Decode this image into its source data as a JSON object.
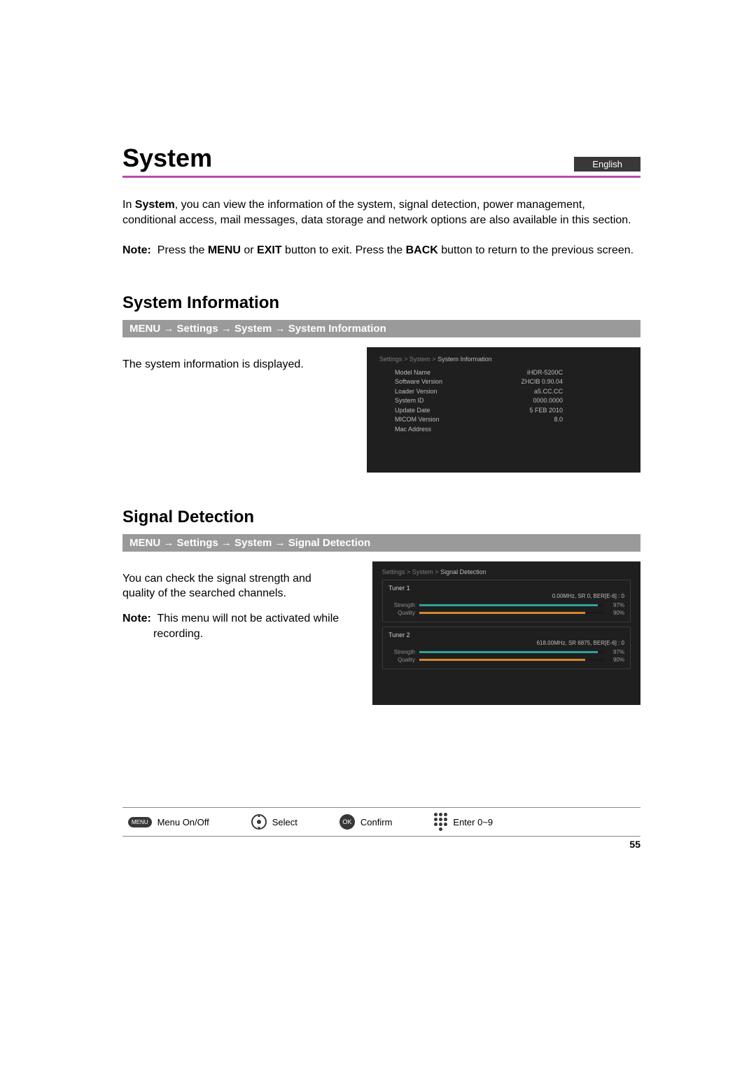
{
  "header": {
    "title": "System",
    "language": "English"
  },
  "intro": {
    "line": "In <b>System</b>, you can view the information of the system, signal detection, power management, conditional access, mail messages, data storage and network options are also available in this section.",
    "note": "<b>Note:</b>&nbsp; Press the <b>MENU</b> or <b>EXIT</b> button to exit. Press the <b>BACK</b> button to return to the previous screen."
  },
  "section1": {
    "heading": "System Information",
    "path": "MENU → Settings → System → System Information",
    "text": "The system information is displayed.",
    "screen": {
      "crumb_prefix": "Settings > System >",
      "crumb_current": "System Information",
      "rows": [
        {
          "label": "Model Name",
          "value": "iHDR-5200C"
        },
        {
          "label": "Software Version",
          "value": "ZHCIB 0.90.04"
        },
        {
          "label": "Loader Version",
          "value": "a5.CC.CC"
        },
        {
          "label": "System ID",
          "value": "0000.0000"
        },
        {
          "label": "Update Date",
          "value": "5 FEB 2010"
        },
        {
          "label": "MICOM Version",
          "value": "8.0"
        },
        {
          "label": "Mac Address",
          "value": ""
        }
      ]
    }
  },
  "section2": {
    "heading": "Signal Detection",
    "path": "MENU → Settings → System → Signal Detection",
    "text": "You can check the signal strength and quality of the searched channels.",
    "note_label": "Note:",
    "note_body": "This menu will not be activated while",
    "note_body2": "recording.",
    "screen": {
      "crumb_prefix": "Settings > System >",
      "crumb_current": "Signal Detection",
      "tuners": [
        {
          "name": "Tuner 1",
          "stat": "0.00MHz, SR 0, BER[E-6] : 0",
          "strength": 97,
          "quality": 90
        },
        {
          "name": "Tuner 2",
          "stat": "618.00MHz, SR 6875, BER[E-6] : 0",
          "strength": 97,
          "quality": 90
        }
      ],
      "labels": {
        "strength": "Strength",
        "quality": "Quality"
      }
    }
  },
  "footer": {
    "items": [
      {
        "icon": "menu",
        "label": "Menu On/Off"
      },
      {
        "icon": "dpad",
        "label": "Select"
      },
      {
        "icon": "ok",
        "label": "Confirm"
      },
      {
        "icon": "numpad",
        "label": "Enter 0~9"
      }
    ],
    "page": "55"
  }
}
